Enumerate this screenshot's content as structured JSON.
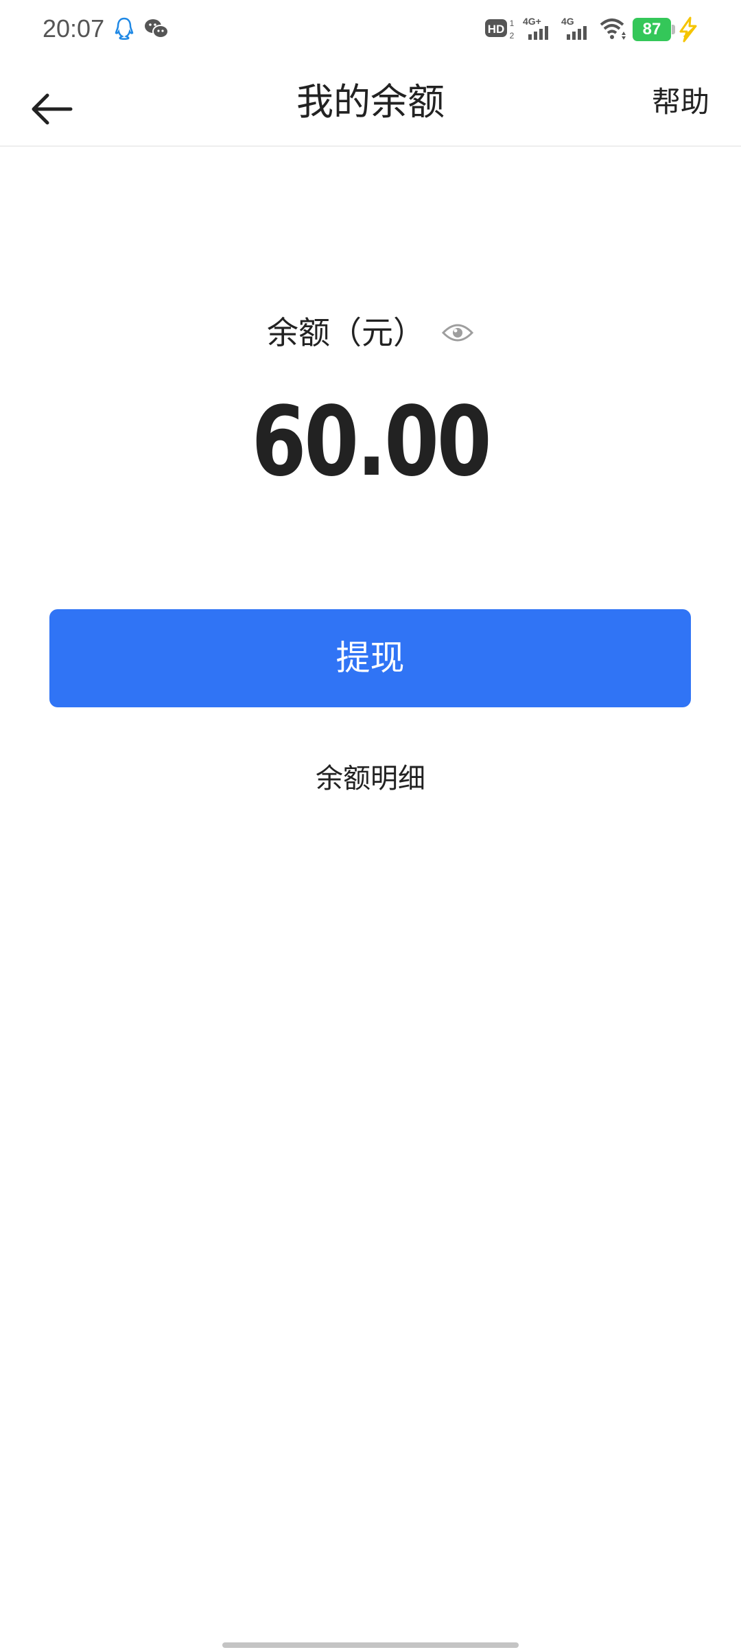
{
  "status_bar": {
    "time": "20:07",
    "battery_level": "87",
    "icons": [
      "qq-icon",
      "wechat-icon",
      "hd-icon",
      "signal-4g-plus-icon",
      "signal-4g-icon",
      "wifi-icon",
      "battery-icon",
      "charging-icon"
    ],
    "hd_label": "HD",
    "net1_label": "4G+",
    "net2_label": "4G"
  },
  "nav": {
    "title": "我的余额",
    "help_label": "帮助"
  },
  "balance": {
    "label": "余额（元）",
    "amount": "60.00"
  },
  "actions": {
    "withdraw_label": "提现",
    "detail_label": "余额明细"
  },
  "colors": {
    "primary": "#3074f5",
    "battery": "#34c759",
    "charging": "#f5c400",
    "qq": "#1e88e5"
  }
}
